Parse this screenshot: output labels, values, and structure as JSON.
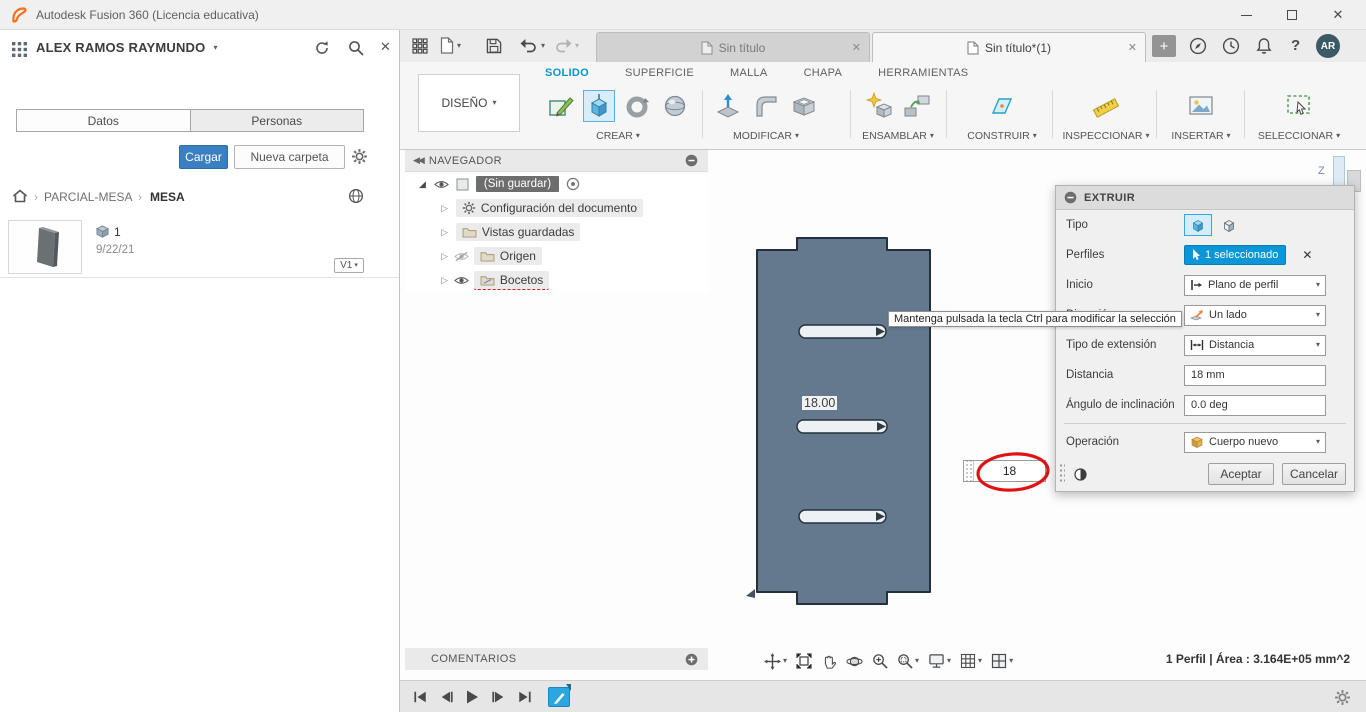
{
  "titlebar": {
    "title": "Autodesk Fusion 360 (Licencia educativa)"
  },
  "data_panel": {
    "user_name": "ALEX RAMOS RAYMUNDO",
    "tabs": {
      "datos": "Datos",
      "personas": "Personas"
    },
    "actions": {
      "upload": "Cargar",
      "new_folder": "Nueva carpeta"
    },
    "breadcrumb": {
      "parent": "PARCIAL-MESA",
      "current": "MESA"
    },
    "item": {
      "name": "1",
      "date": "9/22/21",
      "version": "V1"
    }
  },
  "header": {
    "tabs": {
      "inactive": "Sin título",
      "active": "Sin título*(1)"
    },
    "avatar": "AR"
  },
  "ribbon": {
    "design_menu": "DISEÑO",
    "tabs": {
      "solido": "SOLIDO",
      "superficie": "SUPERFICIE",
      "malla": "MALLA",
      "chapa": "CHAPA",
      "herramientas": "HERRAMIENTAS"
    },
    "groups": {
      "crear": "CREAR",
      "modificar": "MODIFICAR",
      "ensamblar": "ENSAMBLAR",
      "construir": "CONSTRUIR",
      "inspeccionar": "INSPECCIONAR",
      "insertar": "INSERTAR",
      "seleccionar": "SELECCIONAR"
    }
  },
  "navigator": {
    "title": "NAVEGADOR",
    "root": "(Sin guardar)",
    "items": [
      "Configuración del documento",
      "Vistas guardadas",
      "Origen",
      "Bocetos"
    ]
  },
  "canvas": {
    "dimension": "18.00",
    "dimension_input": "18",
    "tooltip": "Mantenga pulsada la tecla Ctrl para modificar la selección",
    "axis_z": "Z"
  },
  "extrude": {
    "title": "EXTRUIR",
    "labels": {
      "tipo": "Tipo",
      "perfiles": "Perfiles",
      "inicio": "Inicio",
      "direccion": "Dirección",
      "tipo_extension": "Tipo de extensión",
      "distancia": "Distancia",
      "angulo": "Ángulo de inclinación",
      "operacion": "Operación"
    },
    "values": {
      "perfiles": "1 seleccionado",
      "inicio": "Plano de perfil",
      "direccion": "Un lado",
      "tipo_extension": "Distancia",
      "distancia": "18 mm",
      "angulo": "0.0 deg",
      "operacion": "Cuerpo nuevo"
    },
    "buttons": {
      "ok": "Aceptar",
      "cancel": "Cancelar"
    }
  },
  "comments": {
    "title": "COMENTARIOS"
  },
  "status": {
    "selection": "1 Perfil | Área : 3.164E+05 mm^2"
  },
  "colors": {
    "accent": "#0696d7",
    "solid_fill": "#64798e",
    "annotation_red": "#e01313"
  }
}
